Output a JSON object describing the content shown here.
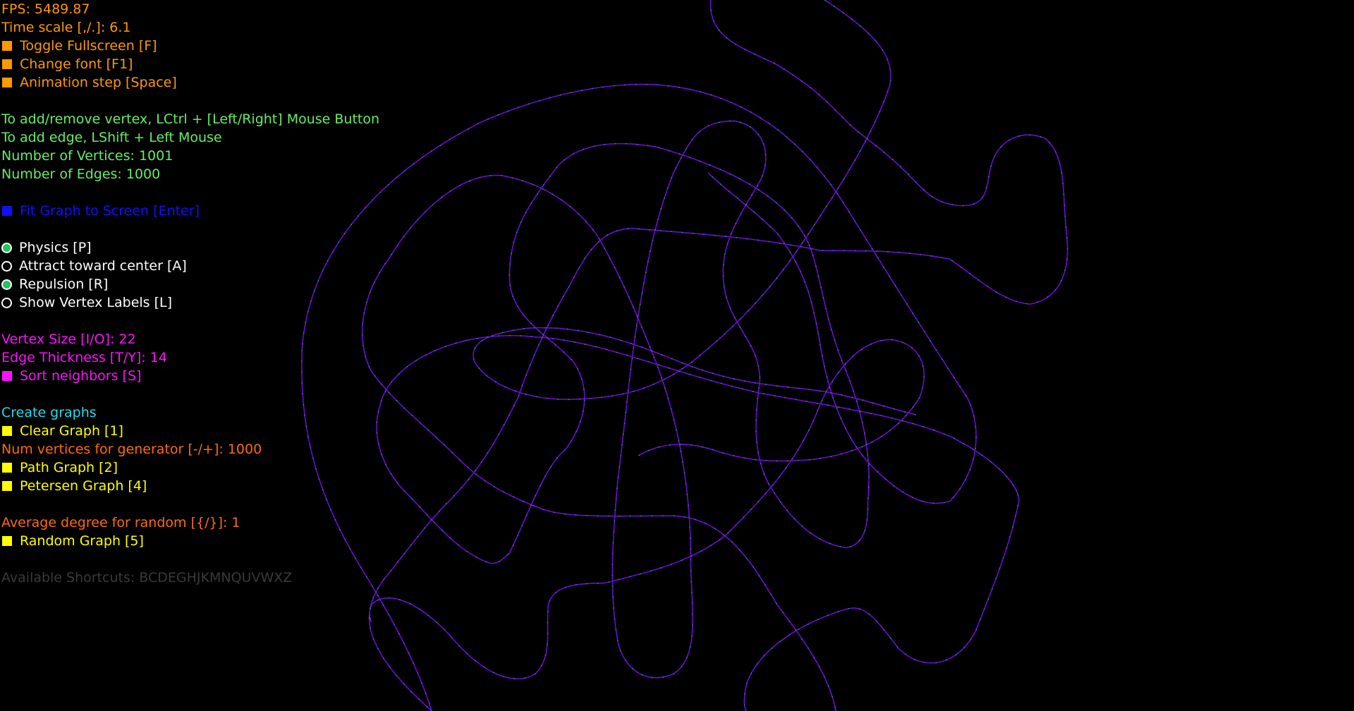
{
  "colors": {
    "background": "#000000",
    "edge": "#6a0dd8",
    "vertex": "#2aa05a",
    "toggle_on": "#22c55e",
    "orange": "#ff9900",
    "green": "#66ee66",
    "blue": "#1010ff",
    "magenta": "#ff10ff",
    "cyan": "#22ddee",
    "yellow": "#ffff00",
    "dark_orange": "#ff6a10",
    "gray": "#3a3a3a"
  },
  "status": {
    "fps": "FPS: 5489.87",
    "time_scale": "Time scale [,/.]: 6.1"
  },
  "app_buttons": [
    {
      "label": "Toggle Fullscreen [F]",
      "icon": "square-button-icon"
    },
    {
      "label": "Change font [F1]",
      "icon": "square-button-icon"
    },
    {
      "label": "Animation step [Space]",
      "icon": "square-button-icon"
    }
  ],
  "help": {
    "add_vertex": "To add/remove vertex, LCtrl + [Left/Right] Mouse Button",
    "add_edge": "To add edge, LShift + Left Mouse",
    "num_vertices": "Number of Vertices: 1001",
    "num_edges": "Number of Edges: 1000"
  },
  "fit_button": {
    "label": "Fit Graph to Screen [Enter]"
  },
  "toggles": [
    {
      "label": "Physics [P]",
      "checked": true
    },
    {
      "label": "Attract toward center [A]",
      "checked": false
    },
    {
      "label": "Repulsion [R]",
      "checked": true
    },
    {
      "label": "Show Vertex Labels [L]",
      "checked": false
    }
  ],
  "appearance": {
    "vertex_size": "Vertex Size [I/O]: 22",
    "edge_thickness": "Edge Thickness [T/Y]: 14",
    "sort_neighbors": "Sort neighbors [S]"
  },
  "create": {
    "heading": "Create graphs",
    "clear": "Clear Graph [1]",
    "num_vertices_generator": "Num vertices for generator [-/+]: 1000",
    "path": "Path Graph [2]",
    "petersen": "Petersen Graph [4]",
    "avg_degree": "Average degree for random [{/}]: 1",
    "random": "Random Graph [5]"
  },
  "shortcuts": "Available Shortcuts: BCDEGHJKMNQUVWXZ",
  "graph": {
    "type": "path graph (tangled, physics layout)",
    "vertices": 1001,
    "edges": 1000
  }
}
